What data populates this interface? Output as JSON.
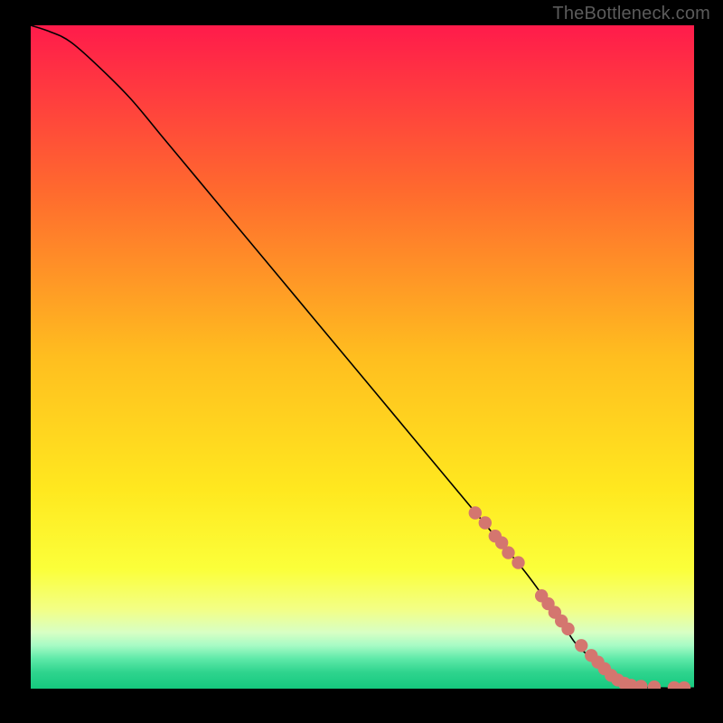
{
  "watermark": "TheBottleneck.com",
  "chart_data": {
    "type": "line",
    "title": "",
    "xlabel": "",
    "ylabel": "",
    "xlim": [
      0,
      100
    ],
    "ylim": [
      0,
      100
    ],
    "grid": false,
    "series": [
      {
        "name": "curve",
        "x": [
          0,
          3,
          6,
          10,
          15,
          20,
          25,
          30,
          35,
          40,
          45,
          50,
          55,
          60,
          65,
          70,
          75,
          80,
          82,
          84,
          86,
          88,
          90,
          93,
          96,
          100
        ],
        "y": [
          100,
          99,
          97.5,
          94,
          89,
          83,
          77,
          71,
          65,
          59,
          53,
          47,
          41,
          35,
          29,
          23,
          17,
          10,
          7,
          5,
          3,
          1.3,
          0.5,
          0.2,
          0.1,
          0.1
        ]
      }
    ],
    "markers": {
      "name": "highlighted-points",
      "color": "#d4766f",
      "x": [
        67,
        68.5,
        70,
        71,
        72,
        73.5,
        77,
        78,
        79,
        80,
        81,
        83,
        84.5,
        85.5,
        86.5,
        87.5,
        88.5,
        89.5,
        90.5,
        92,
        94,
        97,
        98.5
      ],
      "y": [
        26.5,
        25,
        23,
        22,
        20.5,
        19,
        14,
        12.8,
        11.5,
        10.2,
        9,
        6.5,
        5,
        4,
        3,
        2,
        1.3,
        0.8,
        0.5,
        0.35,
        0.25,
        0.15,
        0.12
      ]
    },
    "gradient_bands": [
      {
        "stop": 0.0,
        "color": "#ff1b4b"
      },
      {
        "stop": 0.25,
        "color": "#ff6a2e"
      },
      {
        "stop": 0.5,
        "color": "#ffbe1f"
      },
      {
        "stop": 0.7,
        "color": "#ffe81f"
      },
      {
        "stop": 0.82,
        "color": "#fbff3a"
      },
      {
        "stop": 0.88,
        "color": "#f3ff85"
      },
      {
        "stop": 0.915,
        "color": "#d8ffc4"
      },
      {
        "stop": 0.935,
        "color": "#a7fbc5"
      },
      {
        "stop": 0.955,
        "color": "#5ee9a8"
      },
      {
        "stop": 0.975,
        "color": "#2fd48e"
      },
      {
        "stop": 1.0,
        "color": "#15c97e"
      }
    ]
  }
}
